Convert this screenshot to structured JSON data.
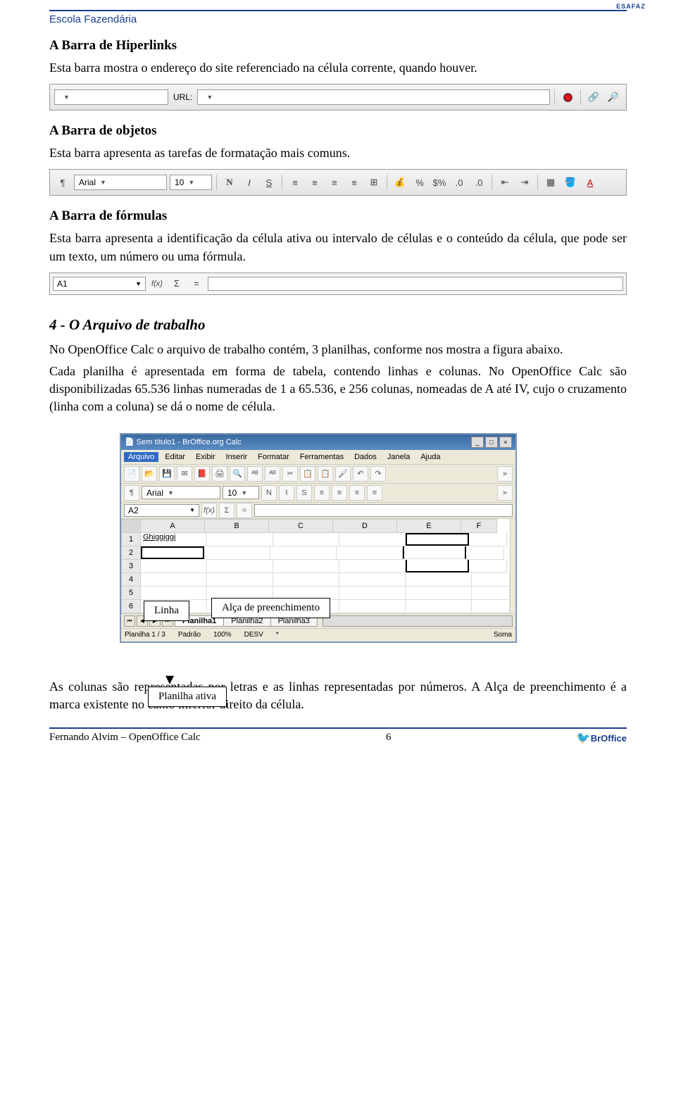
{
  "header": {
    "school": "Escola Fazendária",
    "logo_text": "ESAFAZ"
  },
  "s1": {
    "title": "A Barra de Hiperlinks",
    "text": "Esta barra mostra o endereço do site referenciado na célula corrente, quando houver."
  },
  "hyperbar": {
    "url_label": "URL:"
  },
  "s2": {
    "title": "A Barra de objetos",
    "text": "Esta barra apresenta as tarefas de formatação mais comuns."
  },
  "fmtbar": {
    "font": "Arial",
    "size": "10",
    "bold": "N",
    "italic": "I",
    "under": "S",
    "pct": "%",
    "curr": "$%"
  },
  "s3": {
    "title": "A Barra de fórmulas",
    "text": "Esta barra apresenta a identificação da célula ativa ou intervalo de células e o conteúdo da célula, que pode ser um texto, um número ou uma fórmula."
  },
  "formulabar": {
    "cell": "A1",
    "fx": "f(x)",
    "sigma": "Σ",
    "eq": "="
  },
  "s4": {
    "title": "4 - O Arquivo de trabalho",
    "p1": "No OpenOffice Calc o arquivo de trabalho contém, 3 planilhas, conforme nos mostra a figura abaixo.",
    "p2": "Cada planilha é apresentada em forma de tabela, contendo linhas e colunas. No OpenOffice Calc são disponibilizadas 65.536 linhas numeradas de 1 a 65.536, e 256 colunas, nomeadas de A até IV, cujo o cruzamento (linha com a coluna) se dá o nome de célula."
  },
  "calc": {
    "title": "Sem título1 - BrOffice.org Calc",
    "menu": [
      "Arquivo",
      "Editar",
      "Exibir",
      "Inserir",
      "Formatar",
      "Ferramentas",
      "Dados",
      "Janela",
      "Ajuda"
    ],
    "font": "Arial",
    "size": "10",
    "cellref": "A2",
    "fx": "f(x)",
    "sigma": "Σ",
    "eq": "=",
    "cols": [
      "A",
      "B",
      "C",
      "D",
      "E",
      "F"
    ],
    "rows": [
      "1",
      "2",
      "3",
      "4",
      "5",
      "6"
    ],
    "cellA1": "Ghiggiggi",
    "tabs": [
      "Planilha1",
      "Planilha2",
      "Planilha3"
    ],
    "status": {
      "pages": "Planilha 1 / 3",
      "style": "Padrão",
      "zoom": "100%",
      "mode": "DESV",
      "star": "*",
      "sum": "Soma"
    }
  },
  "annot": {
    "linha": "Linha",
    "alca": "Alça de preenchimento",
    "planilha": "Planilha ativa"
  },
  "s5": {
    "text": "As colunas são representadas por letras e as linhas representadas por números. A Alça de preenchimento é a marca existente no canto inferior direito da célula."
  },
  "footer": {
    "author": "Fernando Alvim – OpenOffice Calc",
    "page": "6",
    "brand": "BrOffice"
  }
}
